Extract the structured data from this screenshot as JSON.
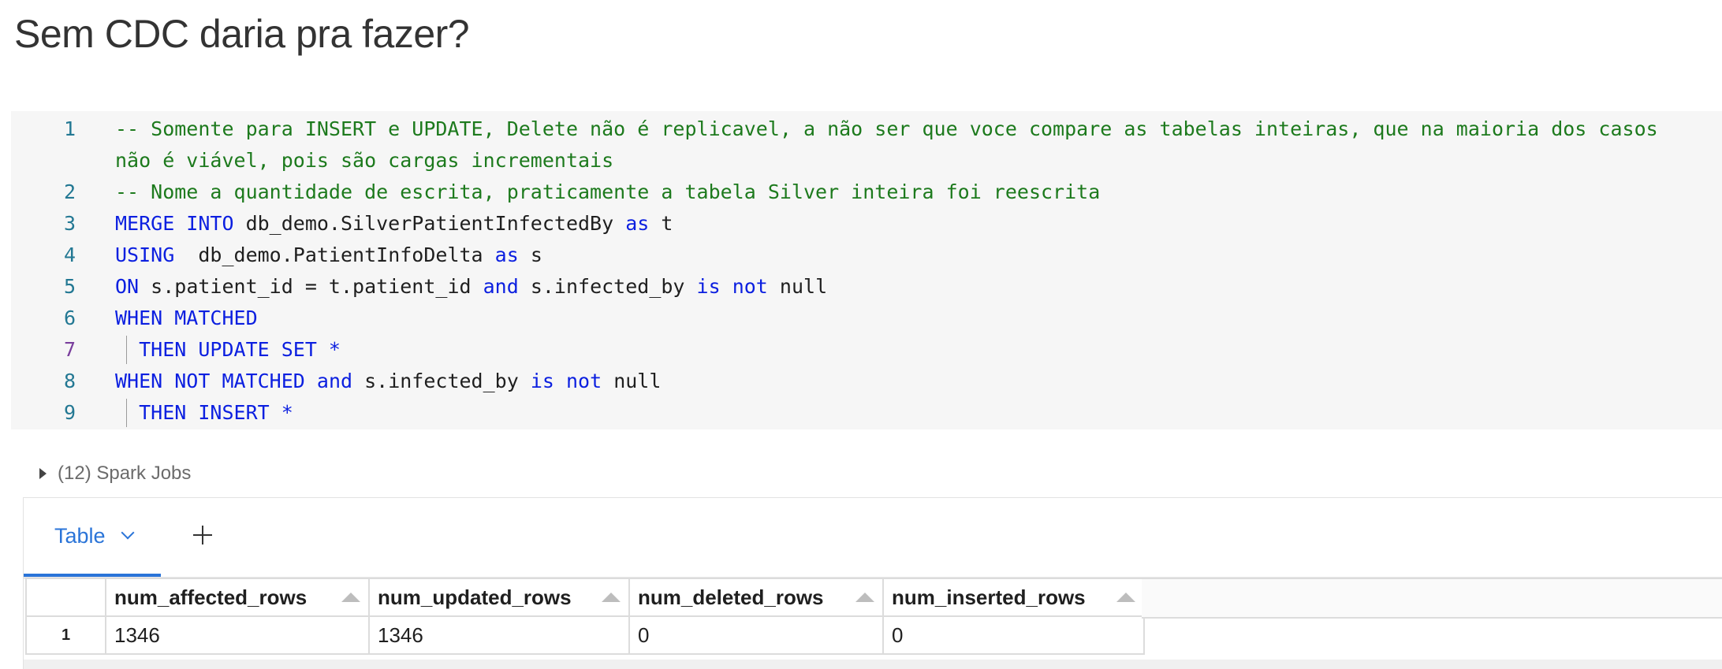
{
  "cell": {
    "title": "Sem CDC daria pra fazer?",
    "code_lines": [
      {
        "num": "1",
        "parts": [
          {
            "t": "-- Somente para INSERT e UPDATE, Delete não é replicavel, a não ser que voce compare as tabelas inteiras, que na maioria dos casos",
            "c": "cmt"
          }
        ]
      },
      {
        "num": "",
        "parts": [
          {
            "t": "não é viável, pois são cargas incrementais",
            "c": "cmt"
          }
        ]
      },
      {
        "num": "2",
        "parts": [
          {
            "t": "-- Nome a quantidade de escrita, praticamente a tabela Silver inteira foi reescrita",
            "c": "cmt"
          }
        ]
      },
      {
        "num": "3",
        "parts": [
          {
            "t": "MERGE INTO",
            "c": "kw"
          },
          {
            "t": " db_demo.SilverPatientInfectedBy ",
            "c": "id"
          },
          {
            "t": "as",
            "c": "kw"
          },
          {
            "t": " t",
            "c": "id"
          }
        ]
      },
      {
        "num": "4",
        "parts": [
          {
            "t": "USING",
            "c": "kw"
          },
          {
            "t": "  db_demo.PatientInfoDelta ",
            "c": "id"
          },
          {
            "t": "as",
            "c": "kw"
          },
          {
            "t": " s",
            "c": "id"
          }
        ]
      },
      {
        "num": "5",
        "parts": [
          {
            "t": "ON",
            "c": "kw"
          },
          {
            "t": " s.patient_id = t.patient_id ",
            "c": "id"
          },
          {
            "t": "and",
            "c": "kw"
          },
          {
            "t": " s.infected_by ",
            "c": "id"
          },
          {
            "t": "is not",
            "c": "kw"
          },
          {
            "t": " null",
            "c": "id"
          }
        ]
      },
      {
        "num": "6",
        "parts": [
          {
            "t": "WHEN MATCHED",
            "c": "kw"
          }
        ]
      },
      {
        "num": "7",
        "active": true,
        "guide": true,
        "parts": [
          {
            "t": "  THEN UPDATE SET *",
            "c": "kw"
          }
        ]
      },
      {
        "num": "8",
        "parts": [
          {
            "t": "WHEN NOT MATCHED",
            "c": "kw"
          },
          {
            "t": " ",
            "c": "id"
          },
          {
            "t": "and",
            "c": "kw"
          },
          {
            "t": " s.infected_by ",
            "c": "id"
          },
          {
            "t": "is not",
            "c": "kw"
          },
          {
            "t": " null",
            "c": "id"
          }
        ]
      },
      {
        "num": "9",
        "guide": true,
        "parts": [
          {
            "t": "  THEN INSERT *",
            "c": "kw"
          }
        ]
      }
    ]
  },
  "jobs": {
    "label": "(12) Spark Jobs"
  },
  "results": {
    "tab_label": "Table",
    "columns": [
      "num_affected_rows",
      "num_updated_rows",
      "num_deleted_rows",
      "num_inserted_rows"
    ],
    "rows": [
      {
        "index": "1",
        "cells": [
          "1346",
          "1346",
          "0",
          "0"
        ]
      }
    ]
  },
  "colors": {
    "keyword": "#0b1fe0",
    "comment": "#1d7a1d",
    "line_number": "#237893",
    "accent": "#2a74d8"
  },
  "icons": {
    "expand": "caret-right-icon",
    "tab_menu": "chevron-down-icon",
    "add": "plus-icon",
    "sort": "sort-up-icon"
  }
}
